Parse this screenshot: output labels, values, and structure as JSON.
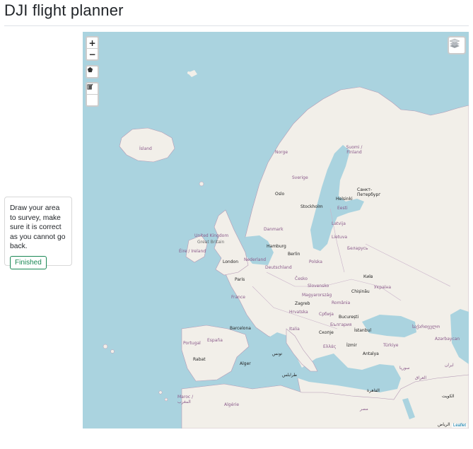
{
  "header": {
    "title": "DJI flight planner"
  },
  "instruction": {
    "text": "Draw your area to survey, make sure it is correct as you cannot go back.",
    "button_label": "Finished"
  },
  "map": {
    "zoom_controls": {
      "zoom_in": "+",
      "zoom_out": "−"
    },
    "attribution": "Leaflet",
    "labels": {
      "island": "Ísland",
      "norge": "Norge",
      "sverige": "Sverige",
      "suomi": "Suomi / Finland",
      "oslo": "Oslo",
      "stockholm": "Stockholm",
      "helsinki": "Helsinki",
      "spb": "Санкт-Петербург",
      "eesti": "Eesti",
      "latvija": "Latvija",
      "lietuva": "Lietuva",
      "danmark": "Danmark",
      "uk": "United Kingdom",
      "gb": "Great Britain",
      "eire": "Éire / Ireland",
      "london": "London",
      "hamburg": "Hamburg",
      "berlin": "Berlin",
      "nederland": "Nederland",
      "deutschland": "Deutschland",
      "polska": "Polska",
      "belarus": "Беларусь",
      "paris": "Paris",
      "cesko": "Česko",
      "kyiv": "Київ",
      "slovensko": "Slovensko",
      "chisinau": "Chișinău",
      "ukraina": "Україна",
      "france": "France",
      "magyarorszag": "Magyarország",
      "zagreb": "Zagreb",
      "romania": "România",
      "hrvatska": "Hrvatska",
      "srbija": "Србија",
      "bucuresti": "București",
      "bulgaria": "България",
      "barcelona": "Barcelona",
      "italia": "Italia",
      "skopje": "Скопје",
      "istanbul": "İstanbul",
      "sakartvelo": "საქართველო",
      "azerbaycan": "Azərbaycan",
      "portugal": "Portugal",
      "espana": "España",
      "hellas": "Ελλάς",
      "izmir": "İzmir",
      "turkiye": "Türkiye",
      "antalya": "Antalya",
      "tunis": "تونس",
      "alger": "Alger",
      "rabat": "Rabat",
      "maroc": "Maroc / المغرب",
      "algerie": "Algérie",
      "tripoli": "طرابلس",
      "syria": "سوريا",
      "iraq": "العراق",
      "cairo": "القاهرة",
      "misr": "مصر",
      "iran": "ایران",
      "kuwait": "الكويت",
      "riyadh": "الرياض"
    }
  }
}
